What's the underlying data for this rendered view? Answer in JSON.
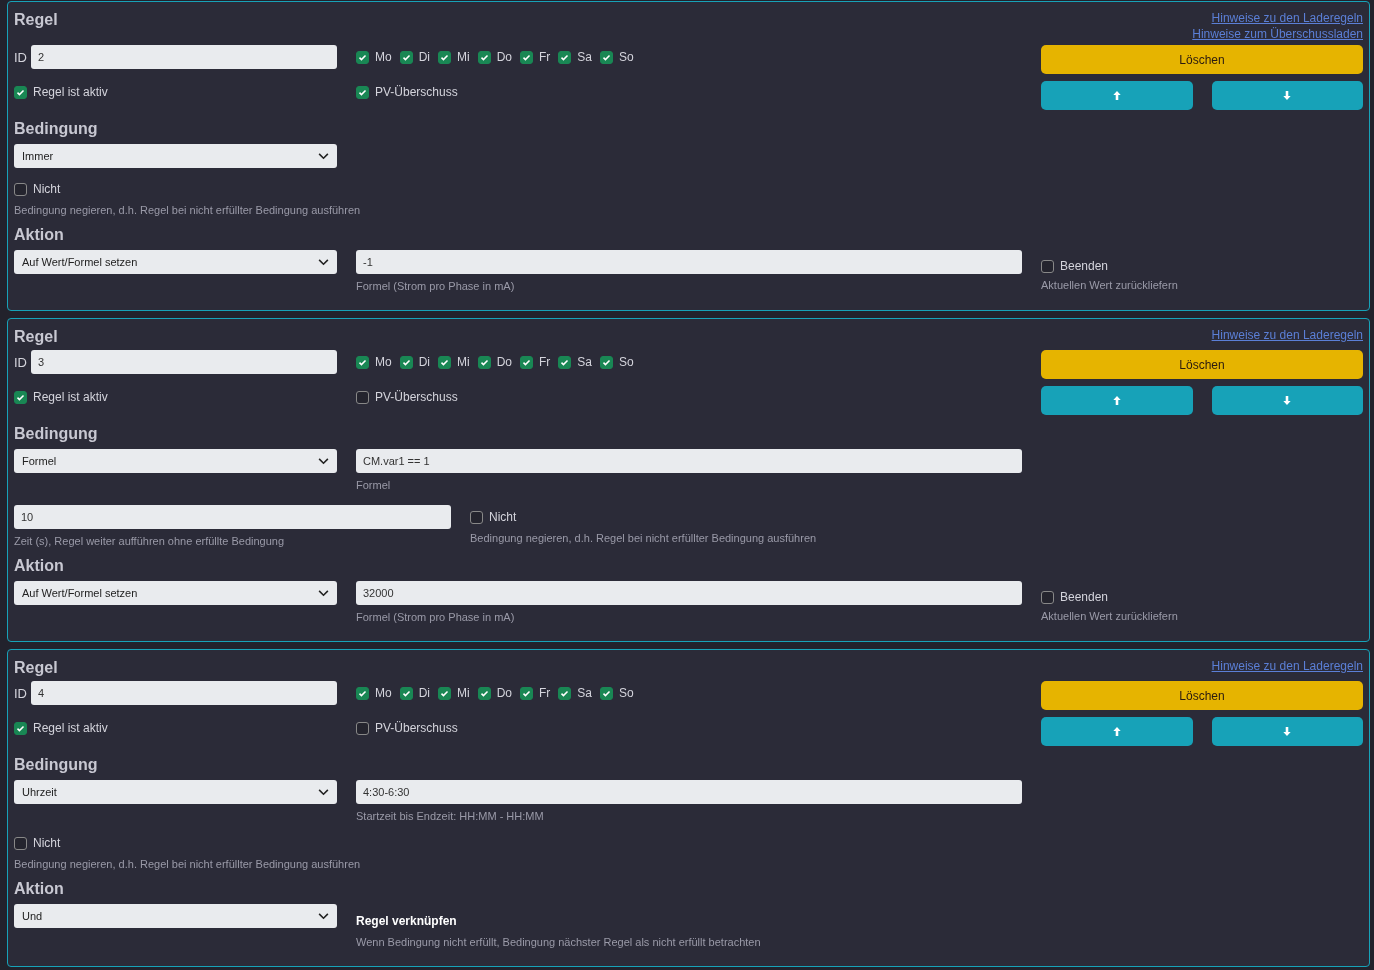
{
  "rules": [
    {
      "title": "Regel",
      "links": [
        "Hinweise zu den Laderegeln",
        "Hinweise zum Überschussladen"
      ],
      "id_label": "ID",
      "id": "2",
      "days": [
        {
          "label": "Mo",
          "checked": true
        },
        {
          "label": "Di",
          "checked": true
        },
        {
          "label": "Mi",
          "checked": true
        },
        {
          "label": "Do",
          "checked": true
        },
        {
          "label": "Fr",
          "checked": true
        },
        {
          "label": "Sa",
          "checked": true
        },
        {
          "label": "So",
          "checked": true
        }
      ],
      "active": {
        "label": "Regel ist aktiv",
        "checked": true
      },
      "pv": {
        "label": "PV-Überschuss",
        "checked": true
      },
      "delete_button": "Löschen",
      "condition": {
        "heading": "Bedingung",
        "select": "Immer",
        "not": {
          "label": "Nicht",
          "checked": false,
          "help": "Bedingung negieren, d.h. Regel bei nicht erfüllter Bedingung ausführen"
        }
      },
      "action": {
        "heading": "Aktion",
        "select": "Auf Wert/Formel setzen",
        "kind": "value",
        "field": {
          "value": "-1",
          "help": "Formel (Strom pro Phase in mA)"
        },
        "end": {
          "label": "Beenden",
          "checked": false,
          "help": "Aktuellen Wert zurückliefern"
        }
      }
    },
    {
      "title": "Regel",
      "links": [
        "Hinweise zu den Laderegeln"
      ],
      "id_label": "ID",
      "id": "3",
      "days": [
        {
          "label": "Mo",
          "checked": true
        },
        {
          "label": "Di",
          "checked": true
        },
        {
          "label": "Mi",
          "checked": true
        },
        {
          "label": "Do",
          "checked": true
        },
        {
          "label": "Fr",
          "checked": true
        },
        {
          "label": "Sa",
          "checked": true
        },
        {
          "label": "So",
          "checked": true
        }
      ],
      "active": {
        "label": "Regel ist aktiv",
        "checked": true
      },
      "pv": {
        "label": "PV-Überschuss",
        "checked": false
      },
      "delete_button": "Löschen",
      "condition": {
        "heading": "Bedingung",
        "select": "Formel",
        "field": {
          "value": "CM.var1 == 1",
          "help": "Formel"
        },
        "delay": {
          "value": "10",
          "help": "Zeit (s), Regel weiter aufführen ohne erfüllte Bedingung"
        },
        "not": {
          "label": "Nicht",
          "checked": false,
          "help": "Bedingung negieren, d.h. Regel bei nicht erfüllter Bedingung ausführen"
        }
      },
      "action": {
        "heading": "Aktion",
        "select": "Auf Wert/Formel setzen",
        "kind": "value",
        "field": {
          "value": "32000",
          "help": "Formel (Strom pro Phase in mA)"
        },
        "end": {
          "label": "Beenden",
          "checked": false,
          "help": "Aktuellen Wert zurückliefern"
        }
      }
    },
    {
      "title": "Regel",
      "links": [
        "Hinweise zu den Laderegeln"
      ],
      "id_label": "ID",
      "id": "4",
      "days": [
        {
          "label": "Mo",
          "checked": true
        },
        {
          "label": "Di",
          "checked": true
        },
        {
          "label": "Mi",
          "checked": true
        },
        {
          "label": "Do",
          "checked": true
        },
        {
          "label": "Fr",
          "checked": true
        },
        {
          "label": "Sa",
          "checked": true
        },
        {
          "label": "So",
          "checked": true
        }
      ],
      "active": {
        "label": "Regel ist aktiv",
        "checked": true
      },
      "pv": {
        "label": "PV-Überschuss",
        "checked": false
      },
      "delete_button": "Löschen",
      "condition": {
        "heading": "Bedingung",
        "select": "Uhrzeit",
        "field": {
          "value": "4:30-6:30",
          "help": "Startzeit bis Endzeit: HH:MM - HH:MM"
        },
        "not": {
          "label": "Nicht",
          "checked": false,
          "help": "Bedingung negieren, d.h. Regel bei nicht erfüllter Bedingung ausführen"
        }
      },
      "action": {
        "heading": "Aktion",
        "select": "Und",
        "kind": "link",
        "title": "Regel verknüpfen",
        "help": "Wenn Bedingung nicht erfüllt, Bedingung nächster Regel als nicht erfüllt betrachten"
      }
    }
  ]
}
